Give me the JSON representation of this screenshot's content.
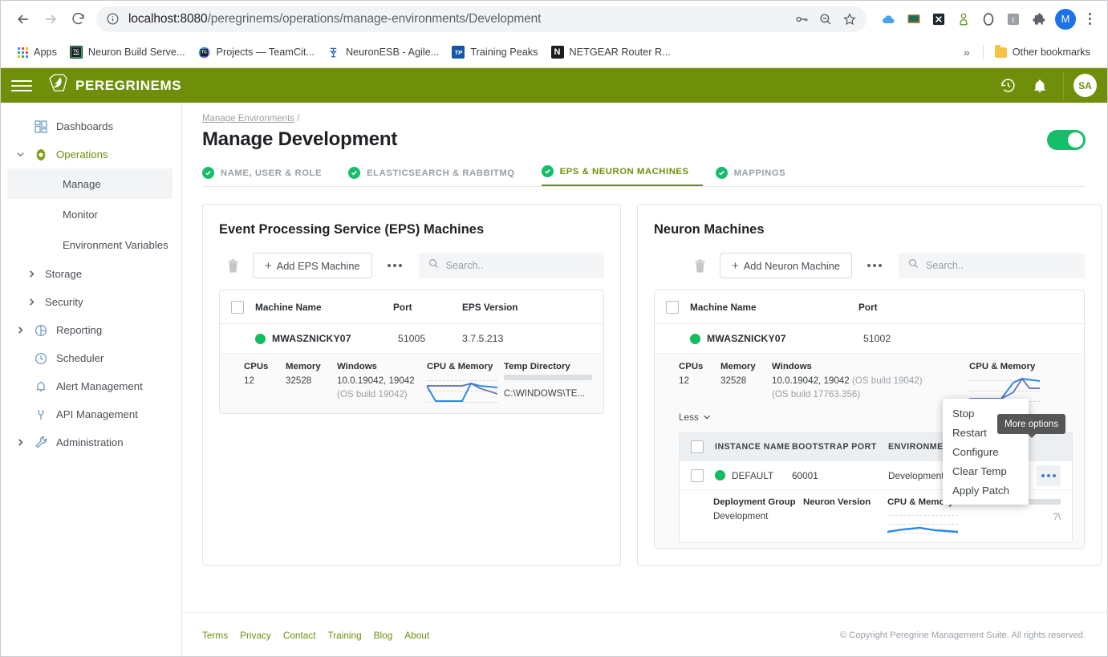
{
  "browser": {
    "back_icon": "back-arrow-icon",
    "forward_icon": "forward-arrow-icon",
    "reload_icon": "reload-icon",
    "site_info_icon": "info-circle-icon",
    "url_host": "localhost:8080",
    "url_path": "/peregrinems/operations/manage-environments/Development",
    "url_full": "localhost:8080/peregrinems/operations/manage-environments/Development",
    "omni_icons": [
      "key-icon",
      "zoom-out-icon",
      "star-icon"
    ],
    "extension_icons": [
      "cloud-icon",
      "screen-icon",
      "x-icon",
      "person-icon",
      "opera-icon",
      "t-icon",
      "puzzle-icon"
    ],
    "profile_initial": "M",
    "menu_icon": "three-dot-menu-icon",
    "bookmarks": [
      {
        "label": "Apps",
        "icon": "apps-grid-icon"
      },
      {
        "label": "Neuron Build Serve...",
        "icon": "teamcity-icon",
        "badge": "TC"
      },
      {
        "label": "Projects — TeamCit...",
        "icon": "teamcity-icon",
        "badge": "TC"
      },
      {
        "label": "NeuronESB - Agile...",
        "icon": "jira-icon",
        "badge": ""
      },
      {
        "label": "Training Peaks",
        "icon": "trainingpeaks-icon",
        "badge": "TP"
      },
      {
        "label": "NETGEAR Router R...",
        "icon": "netgear-icon",
        "badge": "N"
      }
    ],
    "overflow_label": "»",
    "other_bookmarks": "Other bookmarks"
  },
  "app_header": {
    "menu_icon": "hamburger-menu-icon",
    "logo_icon": "peregrine-feather-logo",
    "brand": "PEREGRINEMS",
    "history_icon": "history-clock-icon",
    "notification_icon": "bell-icon",
    "avatar_initials": "SA",
    "bg_color": "#6f8f0b"
  },
  "sidebar": {
    "items": [
      {
        "label": "Dashboards",
        "icon": "dashboard-grid-icon",
        "type": "item",
        "expandable": false
      },
      {
        "label": "Operations",
        "icon": "gear-icon",
        "type": "item",
        "expandable": true,
        "expanded": true,
        "active": true
      },
      {
        "label": "Manage",
        "type": "sub",
        "selected": true
      },
      {
        "label": "Monitor",
        "type": "sub",
        "selected": false
      },
      {
        "label": "Environment Variables",
        "type": "sub",
        "selected": false
      },
      {
        "label": "Storage",
        "type": "subgroup",
        "expandable": true
      },
      {
        "label": "Security",
        "type": "subgroup",
        "expandable": true
      },
      {
        "label": "Reporting",
        "icon": "pie-chart-icon",
        "type": "item",
        "expandable": true
      },
      {
        "label": "Scheduler",
        "icon": "clock-icon",
        "type": "item",
        "expandable": false
      },
      {
        "label": "Alert Management",
        "icon": "bell-icon",
        "type": "item",
        "expandable": false
      },
      {
        "label": "API Management",
        "icon": "plug-icon",
        "type": "item",
        "expandable": false
      },
      {
        "label": "Administration",
        "icon": "wrench-icon",
        "type": "item",
        "expandable": true
      }
    ]
  },
  "page": {
    "breadcrumb": "Manage Environments",
    "breadcrumb_sep": "/",
    "title": "Manage Development",
    "toggle_on": true,
    "toggle_color": "#16bd6a",
    "steps": [
      {
        "label": "NAME, USER & ROLE",
        "complete": true,
        "active": false
      },
      {
        "label": "ELASTICSEARCH & RABBITMQ",
        "complete": true,
        "active": false
      },
      {
        "label": "EPS & NEURON MACHINES",
        "complete": true,
        "active": true
      },
      {
        "label": "MAPPINGS",
        "complete": true,
        "active": false
      }
    ]
  },
  "eps_panel": {
    "title": "Event Processing Service (EPS) Machines",
    "delete_icon": "trash-icon",
    "add_label": "Add EPS Machine",
    "add_plus": "+",
    "more_icon": "three-dots-icon",
    "search_placeholder": "Search..",
    "search_icon": "search-icon",
    "columns": [
      "Machine Name",
      "Port",
      "EPS Version"
    ],
    "rows": [
      {
        "status": "online",
        "name": "MWASZNICKY07",
        "port": "51005",
        "version": "3.7.5.213"
      }
    ],
    "detail": {
      "cpus_label": "CPUs",
      "cpus_value": "12",
      "memory_label": "Memory",
      "memory_value": "32528",
      "os_label": "Windows",
      "os_value": "10.0.19042, 19042",
      "os_build": "(OS build 19042)",
      "chart_label": "CPU & Memory",
      "temp_label": "Temp Directory",
      "temp_value": "C:\\WINDOWS\\TE..."
    }
  },
  "neuron_panel": {
    "title": "Neuron Machines",
    "delete_icon": "trash-icon",
    "add_label": "Add Neuron Machine",
    "add_plus": "+",
    "more_icon": "three-dots-icon",
    "search_placeholder": "Search..",
    "search_icon": "search-icon",
    "columns": [
      "Machine Name",
      "Port"
    ],
    "rows": [
      {
        "status": "online",
        "name": "MWASZNICKY07",
        "port": "51002"
      }
    ],
    "detail": {
      "cpus_label": "CPUs",
      "cpus_value": "12",
      "memory_label": "Memory",
      "memory_value": "32528",
      "os_label": "Windows",
      "os_value": "10.0.19042, 19042",
      "os_build_1": "(OS build 19042)",
      "os_build_2": "(OS build 17763.356)",
      "chart_label": "CPU & Memory",
      "less_label": "Less"
    },
    "instances": {
      "columns": [
        "INSTANCE NAME",
        "BOOTSTRAP PORT",
        "ENVIRONMENT"
      ],
      "rows": [
        {
          "status": "online",
          "name": "DEFAULT",
          "bootstrap_port": "60001",
          "environment": "Development"
        }
      ],
      "detail": {
        "deployment_group_label": "Deployment Group",
        "deployment_group_value": "Development",
        "neuron_version_label": "Neuron Version",
        "neuron_version_value": "",
        "chart_label": "CPU & Memory"
      },
      "row_more_icon": "three-dots-icon"
    }
  },
  "context_menu": {
    "items": [
      "Stop",
      "Restart",
      "Configure",
      "Clear Temp",
      "Apply Patch"
    ]
  },
  "tooltip": {
    "text": "More options"
  },
  "footer": {
    "links": [
      "Terms",
      "Privacy",
      "Contact",
      "Training",
      "Blog",
      "About"
    ],
    "copyright": "© Copyright Peregrine Management Suite. All rights reserved."
  },
  "chart_data": [
    {
      "type": "line",
      "title": "CPU & Memory",
      "series": [
        {
          "name": "CPU",
          "color": "#2d8ae5",
          "values": [
            55,
            5,
            5,
            5,
            5,
            70,
            62,
            62
          ]
        },
        {
          "name": "Memory",
          "color": "#5b6bc0",
          "values": [
            55,
            55,
            55,
            55,
            55,
            70,
            55,
            40
          ]
        }
      ],
      "x": [
        0,
        1,
        2,
        3,
        4,
        5,
        6,
        7
      ],
      "ylim": [
        0,
        100
      ],
      "grid": true,
      "panel": "eps"
    },
    {
      "type": "line",
      "title": "CPU & Memory",
      "series": [
        {
          "name": "CPU",
          "color": "#2d8ae5",
          "values": [
            20,
            20,
            20,
            20,
            20,
            78,
            85,
            85
          ]
        },
        {
          "name": "Memory",
          "color": "#5b6bc0",
          "values": [
            20,
            20,
            20,
            20,
            20,
            78,
            55,
            55
          ]
        }
      ],
      "x": [
        0,
        1,
        2,
        3,
        4,
        5,
        6,
        7
      ],
      "ylim": [
        0,
        100
      ],
      "grid": true,
      "panel": "neuron-machine"
    },
    {
      "type": "line",
      "title": "CPU & Memory",
      "series": [
        {
          "name": "CPU",
          "color": "#2d8ae5",
          "values": [
            5,
            8,
            10,
            8,
            6,
            5,
            5,
            5
          ]
        }
      ],
      "x": [
        0,
        1,
        2,
        3,
        4,
        5,
        6,
        7
      ],
      "ylim": [
        0,
        100
      ],
      "grid": true,
      "panel": "neuron-instance"
    }
  ]
}
